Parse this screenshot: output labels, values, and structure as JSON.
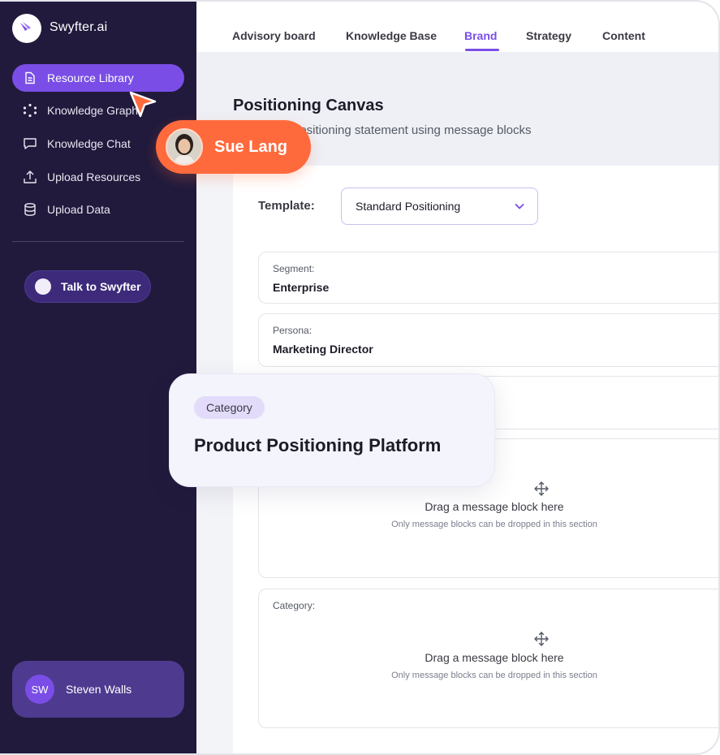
{
  "app": {
    "name": "Swyfter.ai"
  },
  "sidebar": {
    "items": [
      {
        "label": "Resource Library",
        "icon": "document-icon",
        "active": true
      },
      {
        "label": "Knowledge Graph",
        "icon": "graph-icon",
        "active": false
      },
      {
        "label": "Knowledge Chat",
        "icon": "chat-icon",
        "active": false
      },
      {
        "label": "Upload Resources",
        "icon": "upload-icon",
        "active": false
      },
      {
        "label": "Upload Data",
        "icon": "database-icon",
        "active": false
      }
    ],
    "talk_button": "Talk to Swyfter",
    "user": {
      "initials": "SW",
      "name": "Steven Walls"
    }
  },
  "tabs": [
    {
      "label": "Advisory board",
      "active": false
    },
    {
      "label": "Knowledge Base",
      "active": false
    },
    {
      "label": "Brand",
      "active": true
    },
    {
      "label": "Strategy",
      "active": false
    },
    {
      "label": "Content",
      "active": false
    }
  ],
  "page": {
    "title": "Positioning Canvas",
    "subtitle": "positioning statement using message blocks"
  },
  "template": {
    "label": "Template:",
    "selected": "Standard Positioning"
  },
  "fields": {
    "segment": {
      "label": "Segment:",
      "value": "Enterprise"
    },
    "persona": {
      "label": "Persona:",
      "value": "Marketing Director"
    }
  },
  "drop_zones": [
    {
      "label": "",
      "title": "Drag a message block here",
      "hint": "Only message blocks can be dropped in this section"
    },
    {
      "label": "Category:",
      "title": "Drag a message block here",
      "hint": "Only message blocks can be dropped in this section"
    }
  ],
  "overlays": {
    "collaborator": {
      "name": "Sue Lang"
    },
    "category_card": {
      "tag": "Category",
      "title": "Product Positioning Platform"
    }
  },
  "colors": {
    "sidebar_bg": "#211a3c",
    "accent": "#7a4ee6",
    "collaborator": "#ff6a3d"
  }
}
